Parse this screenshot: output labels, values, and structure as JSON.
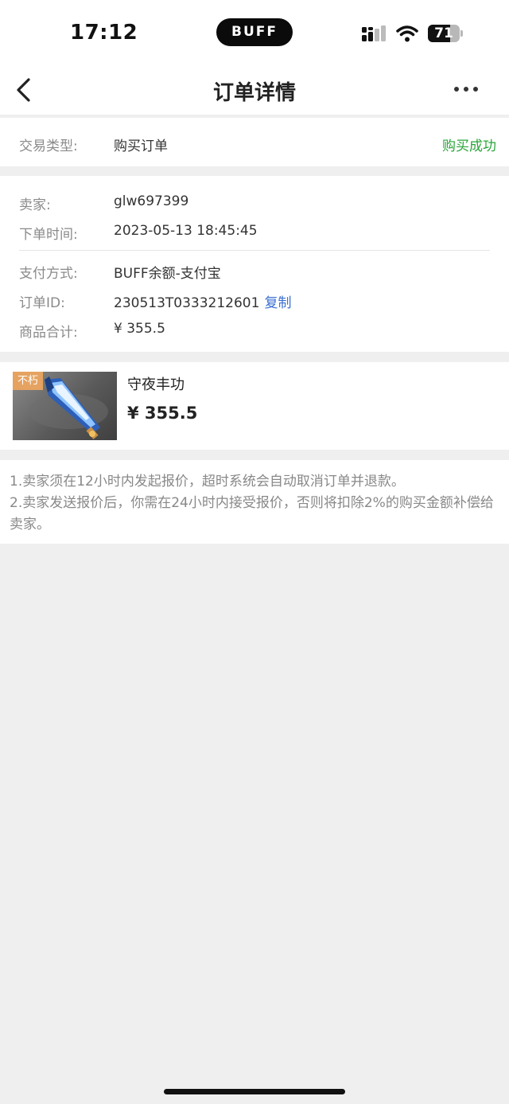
{
  "status_bar": {
    "time": "17:12",
    "island_label": "BUFF",
    "battery": "71"
  },
  "nav": {
    "title": "订单详情"
  },
  "trade": {
    "type_label": "交易类型:",
    "type_value": "购买订单",
    "status": "购买成功",
    "status_color": "#2aa53a"
  },
  "order": {
    "seller_label": "卖家:",
    "seller_value": "glw697399",
    "time_label": "下单时间:",
    "time_value": "2023-05-13 18:45:45",
    "payment_label": "支付方式:",
    "payment_value": "BUFF余额-支付宝",
    "id_label": "订单ID:",
    "id_value": "230513T0333212601",
    "copy_label": "复制",
    "total_label": "商品合计:",
    "total_value": "¥ 355.5"
  },
  "item": {
    "badge": "不朽",
    "name": "守夜丰功",
    "price": "¥ 355.5",
    "image_icon": "sword-icon"
  },
  "notes": {
    "line1": "1.卖家须在12小时内发起报价，超时系统会自动取消订单并退款。",
    "line2": "2.卖家发送报价后，你需在24小时内接受报价，否则将扣除2%的购买金额补偿给卖家。"
  },
  "colors": {
    "accent_link": "#3b6fd0",
    "badge": "#e5a260",
    "background": "#efefef"
  }
}
